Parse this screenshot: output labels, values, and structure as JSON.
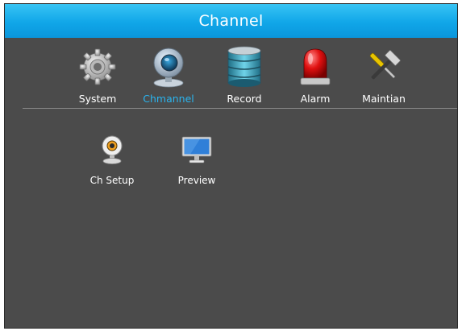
{
  "window": {
    "title": "Channel"
  },
  "nav": {
    "items": [
      {
        "label": "System",
        "icon": "gear-icon",
        "active": false
      },
      {
        "label": "Chmannel",
        "icon": "camera-icon",
        "active": true
      },
      {
        "label": "Record",
        "icon": "hard-disk-icon",
        "active": false
      },
      {
        "label": "Alarm",
        "icon": "siren-icon",
        "active": false
      },
      {
        "label": "Maintian",
        "icon": "tools-icon",
        "active": false
      }
    ]
  },
  "sub": {
    "items": [
      {
        "label": "Ch Setup",
        "icon": "webcam-icon"
      },
      {
        "label": "Preview",
        "icon": "monitor-icon"
      }
    ]
  },
  "colors": {
    "title_bar": "#10a6e8",
    "background": "#4b4b4b",
    "active_label": "#2ab4ee"
  }
}
